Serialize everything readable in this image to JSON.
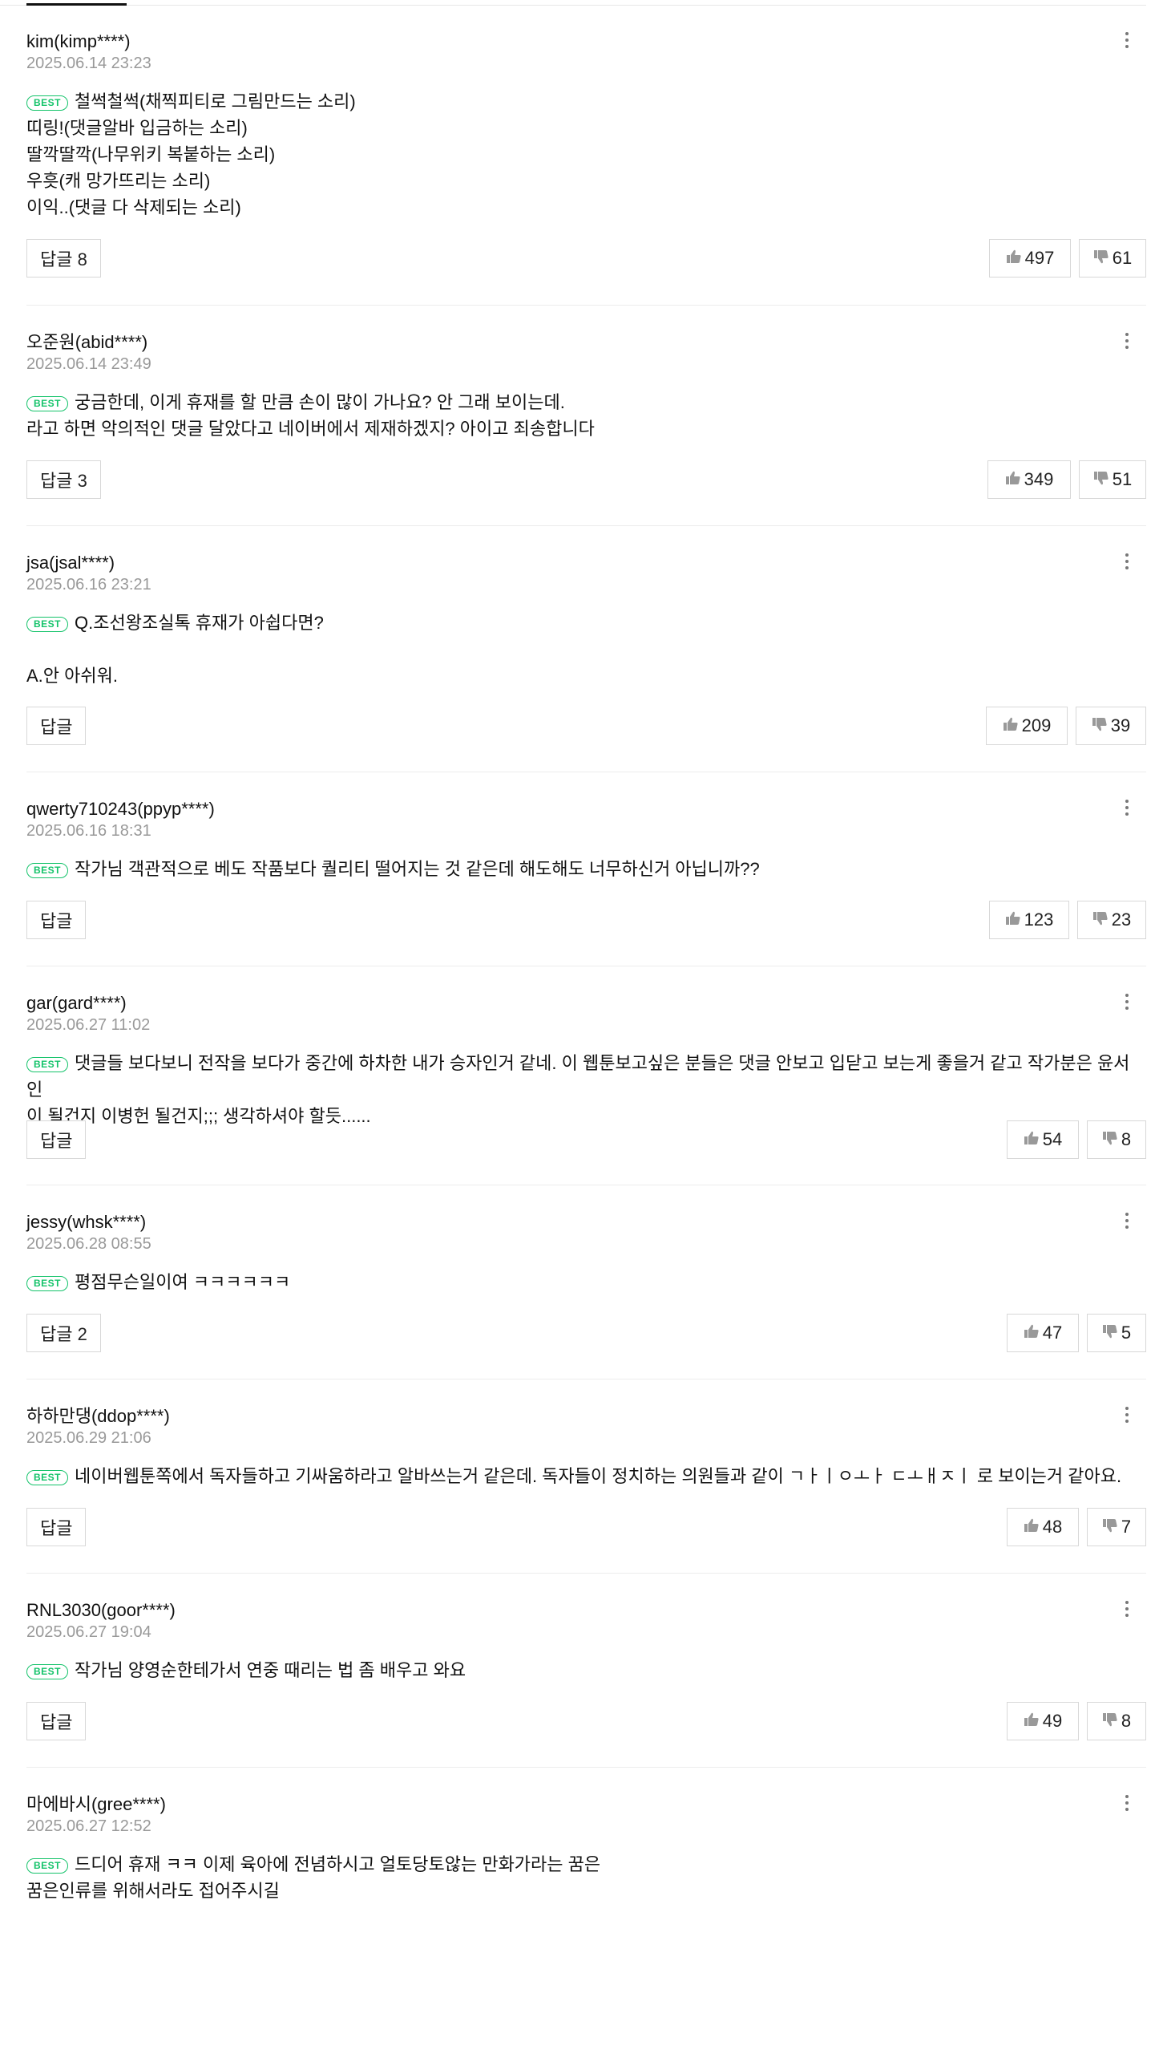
{
  "comments": [
    {
      "author": "kim(kimp****)",
      "date": "2025.06.14 23:23",
      "best": true,
      "badge": "BEST",
      "text": "철썩철썩(채찍피티로 그림만드는 소리)\n띠링!(댓글알바 입금하는 소리)\n딸깍딸깍(나무위키 복붙하는 소리)\n우흣(캐 망가뜨리는 소리)\n이익..(댓글 다 삭제되는 소리)",
      "reply_label": "답글 8",
      "likes": "497",
      "dislikes": "61"
    },
    {
      "author": "오준원(abid****)",
      "date": "2025.06.14 23:49",
      "best": true,
      "badge": "BEST",
      "text": "궁금한데, 이게 휴재를 할 만큼 손이 많이 가나요? 안 그래 보이는데.\n라고 하면 악의적인 댓글 달았다고 네이버에서 제재하겠지? 아이고 죄송합니다",
      "reply_label": "답글 3",
      "likes": "349",
      "dislikes": "51"
    },
    {
      "author": "jsa(jsal****)",
      "date": "2025.06.16 23:21",
      "best": true,
      "badge": "BEST",
      "text": "Q.조선왕조실톡 휴재가 아쉽다면?\n\nA.안 아쉬워.",
      "reply_label": "답글",
      "likes": "209",
      "dislikes": "39"
    },
    {
      "author": "qwerty710243(ppyp****)",
      "date": "2025.06.16 18:31",
      "best": true,
      "badge": "BEST",
      "text": "작가님 객관적으로 베도 작품보다 퀄리티 떨어지는 것 같은데 해도해도 너무하신거 아닙니까??",
      "reply_label": "답글",
      "likes": "123",
      "dislikes": "23"
    },
    {
      "author": "gar(gard****)",
      "date": "2025.06.27 11:02",
      "best": true,
      "badge": "BEST",
      "text": "댓글들 보다보니 전작을 보다가 중간에 하차한 내가 승자인거 같네. 이 웹툰보고싶은 분들은 댓글 안보고 입닫고 보는게 좋을거 같고 작가분은 윤서인\n이 될건지 이병헌 될건지;;; 생각하셔야 할듯......",
      "reply_label": "답글",
      "likes": "54",
      "dislikes": "8"
    },
    {
      "author": "jessy(whsk****)",
      "date": "2025.06.28 08:55",
      "best": true,
      "badge": "BEST",
      "text": "평점무슨일이여 ㅋㅋㅋㅋㅋㅋ",
      "reply_label": "답글 2",
      "likes": "47",
      "dislikes": "5"
    },
    {
      "author": "하하만댕(ddop****)",
      "date": "2025.06.29 21:06",
      "best": true,
      "badge": "BEST",
      "text": "네이버웹툰쪽에서 독자들하고 기싸움하라고 알바쓰는거 같은데. 독자들이 정치하는 의원들과 같이 ㄱㅏㅣㅇㅗㅏ ㄷㅗㅐㅈㅣ 로 보이는거 같아요.",
      "reply_label": "답글",
      "likes": "48",
      "dislikes": "7"
    },
    {
      "author": "RNL3030(goor****)",
      "date": "2025.06.27 19:04",
      "best": true,
      "badge": "BEST",
      "text": "작가님 양영순한테가서 연중 때리는 법 좀 배우고 와요",
      "reply_label": "답글",
      "likes": "49",
      "dislikes": "8"
    },
    {
      "author": "마에바시(gree****)",
      "date": "2025.06.27 12:52",
      "best": true,
      "badge": "BEST",
      "text": "드디어 휴재 ㅋㅋ 이제 육아에 전념하시고 얼토당토않는 만화가라는 꿈은\n꿈은인류를 위해서라도 접어주시길",
      "reply_label": "",
      "likes": "",
      "dislikes": ""
    }
  ]
}
